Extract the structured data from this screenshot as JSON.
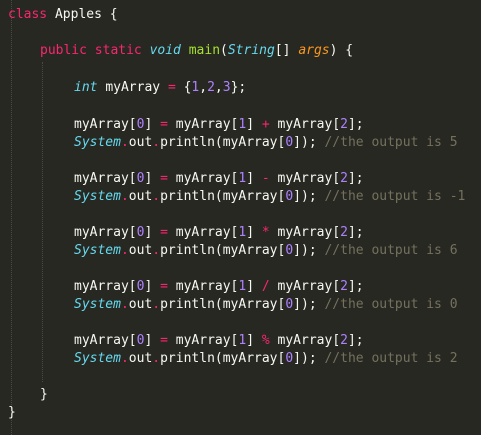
{
  "code": {
    "class_decl": {
      "keyword": "class",
      "name": "Apples",
      "brace": "{"
    },
    "method_decl": {
      "modifiers": "public static",
      "return_type": "void",
      "name": "main",
      "param_type": "String",
      "param_array": "[]",
      "param_name": "args",
      "brace": "{"
    },
    "array_decl": {
      "type": "int",
      "var": "myArray",
      "eq": "=",
      "open": "{",
      "values": [
        "1",
        "2",
        "3"
      ],
      "close": "};"
    },
    "operations": [
      {
        "op": "+",
        "comment": "//the output is 5"
      },
      {
        "op": "-",
        "comment": "//the output is -1"
      },
      {
        "op": "*",
        "comment": "//the output is 6"
      },
      {
        "op": "/",
        "comment": "//the output is 0"
      },
      {
        "op": "%",
        "comment": "//the output is 2"
      }
    ],
    "closing_method": "}",
    "closing_class": "}"
  }
}
